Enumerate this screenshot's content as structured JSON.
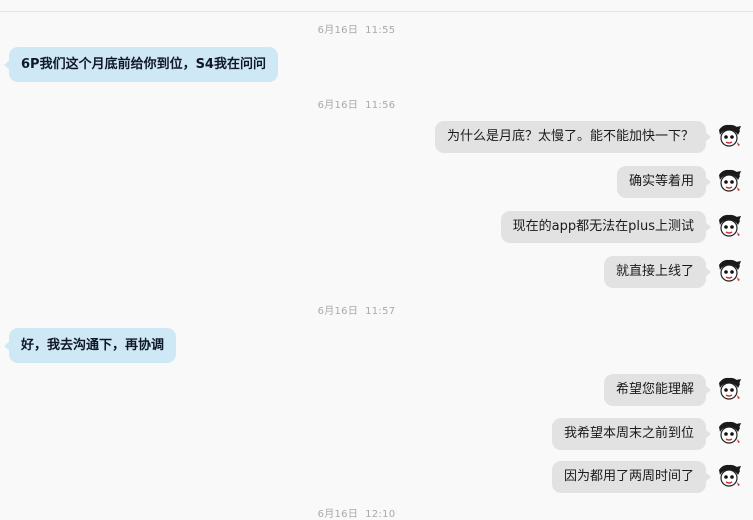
{
  "timestamps": [
    "6月16日  11:55",
    "6月16日  11:56",
    "6月16日  11:57",
    "6月16日  12:10"
  ],
  "messages": [
    {
      "side": "in",
      "text": "6P我们这个月底前给你到位，S4我在问问"
    },
    {
      "side": "out",
      "text": "为什么是月底？太慢了。能不能加快一下？"
    },
    {
      "side": "out",
      "text": "确实等着用"
    },
    {
      "side": "out",
      "text": "现在的app都无法在plus上测试"
    },
    {
      "side": "out",
      "text": "就直接上线了"
    },
    {
      "side": "in",
      "text": "好，我去沟通下，再协调"
    },
    {
      "side": "out",
      "text": "希望您能理解"
    },
    {
      "side": "out",
      "text": "我希望本周末之前到位"
    },
    {
      "side": "out",
      "text": "因为都用了两周时间了"
    }
  ],
  "avatar_icon": "cartoon-face-avatar",
  "colors": {
    "background": "#f9f9f9",
    "incoming_bubble": "#cfe8f6",
    "outgoing_bubble": "#e2e2e2",
    "timestamp": "#a9a9a9"
  }
}
